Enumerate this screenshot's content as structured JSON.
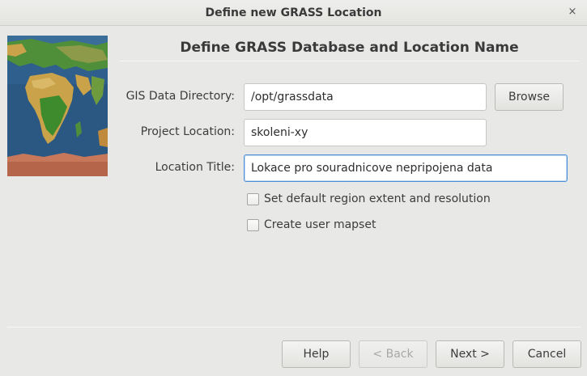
{
  "window": {
    "title": "Define new GRASS Location",
    "close_glyph": "×"
  },
  "heading": "Define GRASS Database and Location Name",
  "form": {
    "gis_data_directory": {
      "label": "GIS Data Directory:",
      "value": "/opt/grassdata"
    },
    "project_location": {
      "label": "Project Location:",
      "value": "skoleni-xy"
    },
    "location_title": {
      "label": "Location Title:",
      "value": "Lokace pro souradnicove nepripojena data"
    },
    "browse_label": "Browse"
  },
  "options": {
    "default_region": {
      "label": "Set default region extent and resolution",
      "checked": false
    },
    "create_mapset": {
      "label": "Create user mapset",
      "checked": false
    }
  },
  "footer": {
    "help_label": "Help",
    "back_label": "< Back",
    "next_label": "Next >",
    "cancel_label": "Cancel"
  },
  "colors": {
    "ocean": "#2f5f8c",
    "land_green": "#3e8b2e",
    "desert": "#c9a24a",
    "antarctica_rust": "#b5654a",
    "focus": "#4a90d9"
  }
}
